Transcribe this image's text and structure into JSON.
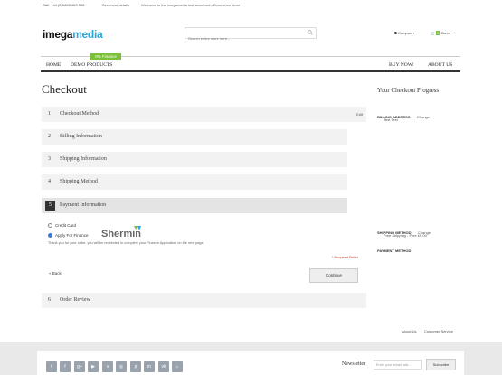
{
  "topbar": {
    "phone": "Call: +44 (0)1865 463 508",
    "more": "See more details",
    "welcome": "Welcome to the Imegamedia test storefront eCommerce store"
  },
  "logo": {
    "part1": "imega",
    "part2": "media"
  },
  "search": {
    "placeholder": "Search entire store here..."
  },
  "header": {
    "compare": "Compare",
    "cart": "Cart",
    "cart_count": "0"
  },
  "nav": {
    "items": [
      "Home",
      "Demo Products",
      "Buy Now!",
      "About Us"
    ],
    "badge": "0% Finance"
  },
  "page_title": "Checkout",
  "steps": [
    {
      "num": "1",
      "label": "Checkout Method",
      "edit": "Edit"
    },
    {
      "num": "2",
      "label": "Billing Information"
    },
    {
      "num": "3",
      "label": "Shipping Information"
    },
    {
      "num": "4",
      "label": "Shipping Method"
    },
    {
      "num": "5",
      "label": "Payment Information"
    },
    {
      "num": "6",
      "label": "Order Review"
    }
  ],
  "payment": {
    "option1": "Credit Card",
    "option2": "Apply For Finance",
    "note": "Thank you for your order, you will be redirected to complete your Finance Application on the next page",
    "required": "* Required Fields",
    "back": "« Back",
    "continue": "Continue",
    "watermark": "Shermin"
  },
  "progress": {
    "title": "Your Checkout Progress",
    "billing_head": "BILLING ADDRESS",
    "billing_change": "Change",
    "billing_value": "Test Test",
    "shipping_head": "SHIPPING METHOD",
    "shipping_change": "Change",
    "shipping_value": "Free Shipping - Free £0.00",
    "payment_head": "PAYMENT METHOD"
  },
  "footer": {
    "about": "About Us",
    "service": "Customer Service",
    "newsletter": "Newsletter",
    "email_placeholder": "Enter your email add...",
    "subscribe": "Subscribe",
    "social": [
      "t",
      "f",
      "g+",
      "▶",
      "v",
      "◎",
      "p",
      "in",
      "vk",
      "⌂"
    ]
  },
  "colors": {
    "accent": "#2aa6d9",
    "badge": "#7cc03a"
  }
}
